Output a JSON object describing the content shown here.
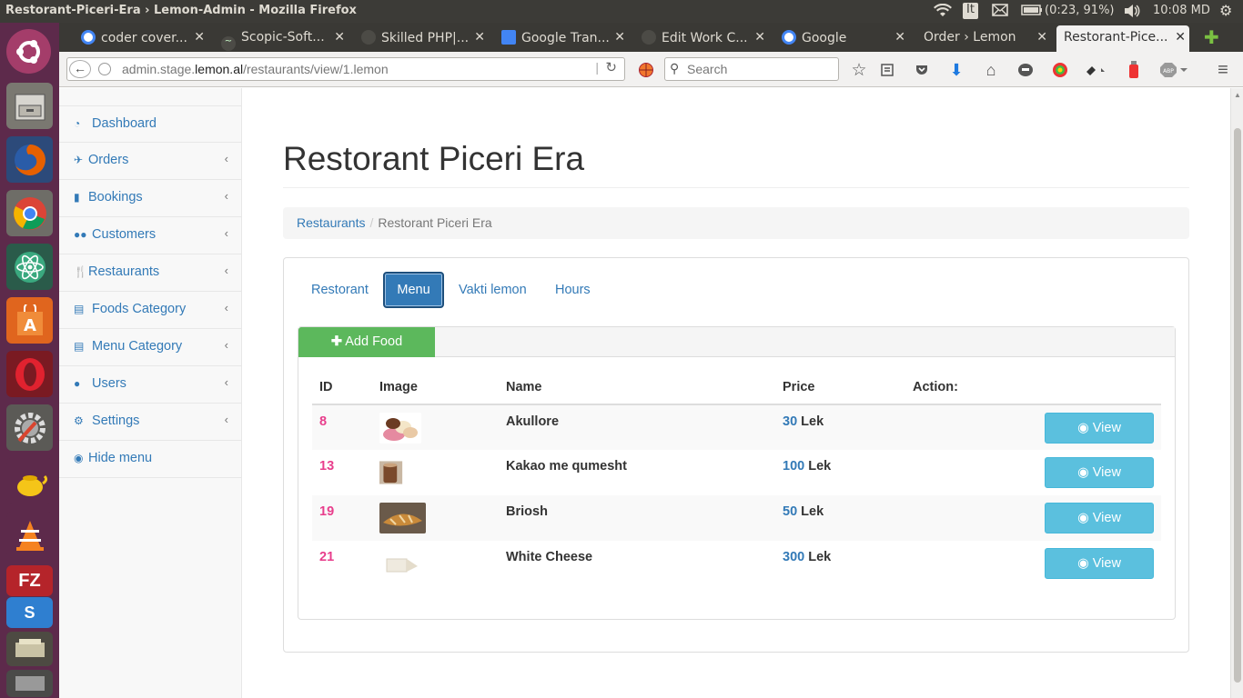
{
  "os": {
    "window_title": "Restorant-Piceri-Era › Lemon-Admin - Mozilla Firefox",
    "keyboard": "It",
    "battery": "(0:23, 91%)",
    "clock": "10:08 MD"
  },
  "browser": {
    "tabs": [
      {
        "label": "coder cover...",
        "icon": "google-icon"
      },
      {
        "label": "Scopic-Soft...",
        "icon": "upwork-icon"
      },
      {
        "label": "Skilled PHP|...",
        "icon": "upwork-icon"
      },
      {
        "label": "Google Tran...",
        "icon": "translate-icon"
      },
      {
        "label": "Edit Work C...",
        "icon": "upwork-icon"
      },
      {
        "label": "Google",
        "icon": "google-icon"
      },
      {
        "label": "Order › Lemon",
        "icon": ""
      },
      {
        "label": "Restorant-Pice...",
        "icon": ""
      }
    ],
    "url_prefix": "admin.stage.",
    "url_domain": "lemon.al",
    "url_path": "/restaurants/view/1.lemon",
    "search_placeholder": "Search"
  },
  "sidebar": {
    "items": [
      {
        "label": "Dashboard",
        "icon": "dashboard-icon",
        "chevron": false
      },
      {
        "label": "Orders",
        "icon": "pin-icon",
        "chevron": true
      },
      {
        "label": "Bookings",
        "icon": "bookmark-icon",
        "chevron": true
      },
      {
        "label": "Customers",
        "icon": "users-icon",
        "chevron": true
      },
      {
        "label": "Restaurants",
        "icon": "cutlery-icon",
        "chevron": true
      },
      {
        "label": "Foods Category",
        "icon": "list-icon",
        "chevron": true
      },
      {
        "label": "Menu Category",
        "icon": "list-icon",
        "chevron": true
      },
      {
        "label": "Users",
        "icon": "user-icon",
        "chevron": true
      },
      {
        "label": "Settings",
        "icon": "cogs-icon",
        "chevron": true
      },
      {
        "label": "Hide menu",
        "icon": "eye-slash-icon",
        "chevron": false
      }
    ]
  },
  "main": {
    "title": "Restorant Piceri Era",
    "breadcrumb": {
      "link": "Restaurants",
      "current": "Restorant Piceri Era"
    },
    "tabs": [
      "Restorant",
      "Menu",
      "Vakti lemon",
      "Hours"
    ],
    "active_tab": "Menu",
    "add_food_label": "Add Food",
    "table": {
      "headers": [
        "ID",
        "Image",
        "Name",
        "Price",
        "Action:"
      ],
      "rows": [
        {
          "id": "8",
          "name": "Akullore",
          "price": "30",
          "currency": "Lek",
          "action": "View"
        },
        {
          "id": "13",
          "name": "Kakao me qumesht",
          "price": "100",
          "currency": "Lek",
          "action": "View"
        },
        {
          "id": "19",
          "name": "Briosh",
          "price": "50",
          "currency": "Lek",
          "action": "View"
        },
        {
          "id": "21",
          "name": "White Cheese",
          "price": "300",
          "currency": "Lek",
          "action": "View"
        }
      ]
    }
  },
  "colors": {
    "link": "#337ab7",
    "success": "#5cb85c",
    "info": "#5bc0de",
    "id_pink": "#e83e8c",
    "launcher": "#5d2a4b"
  }
}
